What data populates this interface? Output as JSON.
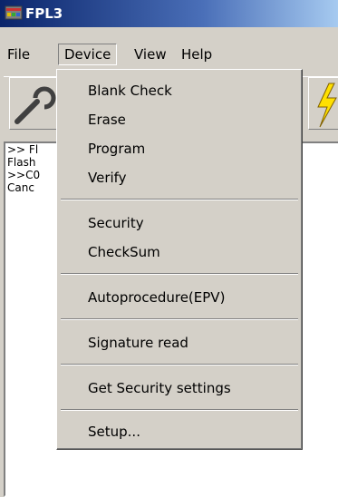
{
  "window": {
    "title": "FPL3"
  },
  "menubar": {
    "items": [
      "File",
      "Device",
      "View",
      "Help"
    ]
  },
  "device_menu": {
    "items": [
      "Blank Check",
      "Erase",
      "Program",
      "Verify",
      "Security",
      "CheckSum",
      "Autoprocedure(EPV)",
      "Signature read",
      "Get Security settings",
      "Setup..."
    ]
  },
  "log": {
    "lines": [
      ">> Fl",
      "Flash",
      ">>C0",
      "Canc"
    ]
  }
}
